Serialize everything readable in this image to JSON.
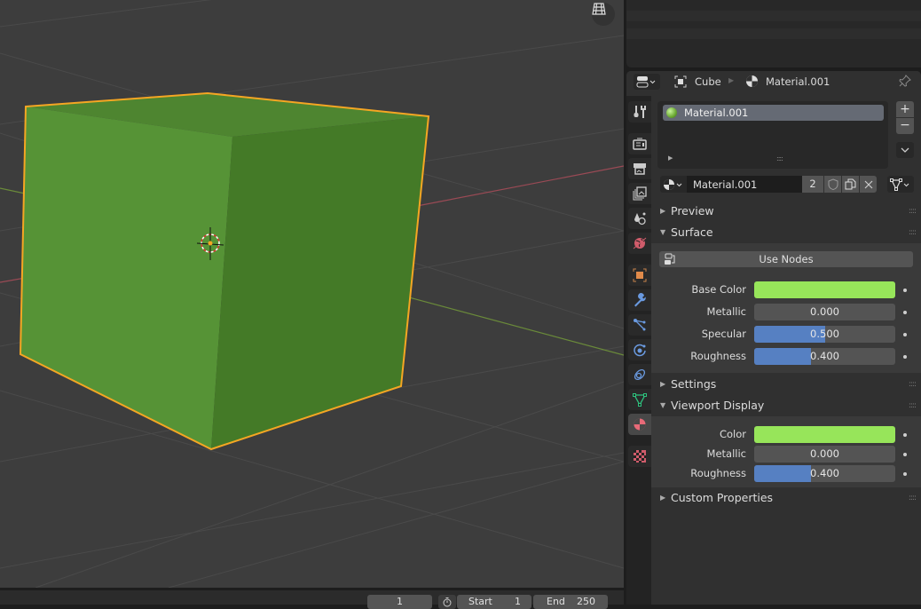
{
  "viewport": {
    "object_name": "Cube",
    "cube_color": "#5a9a36",
    "selection_outline_color": "#f5a623",
    "gizmo_icon": "grid-view-icon"
  },
  "timeline": {
    "current_frame": "1",
    "start_label": "Start",
    "start_value": "1",
    "end_label": "End",
    "end_value": "250",
    "stopwatch_icon": "stopwatch-icon"
  },
  "properties": {
    "header": {
      "editor_icon": "properties-editor-icon",
      "object_label": "Cube",
      "material_label": "Material.001",
      "pin_icon": "pin-icon"
    },
    "tabs": [
      {
        "name": "tool",
        "icon": "tool-icon",
        "color": "#cccccc"
      },
      {
        "name": "render",
        "icon": "render-icon",
        "color": "#cccccc"
      },
      {
        "name": "output",
        "icon": "output-icon",
        "color": "#cccccc"
      },
      {
        "name": "view-layer",
        "icon": "view-layer-icon",
        "color": "#cccccc"
      },
      {
        "name": "scene",
        "icon": "scene-icon",
        "color": "#cccccc"
      },
      {
        "name": "world",
        "icon": "world-icon",
        "color": "#d05c6b"
      },
      {
        "name": "object",
        "icon": "object-icon",
        "color": "#e08a4a"
      },
      {
        "name": "modifiers",
        "icon": "wrench-icon",
        "color": "#6a9ae0"
      },
      {
        "name": "particles",
        "icon": "particles-icon",
        "color": "#6a9ae0"
      },
      {
        "name": "physics",
        "icon": "physics-icon",
        "color": "#6a9ae0"
      },
      {
        "name": "constraints",
        "icon": "constraints-icon",
        "color": "#6a9ae0"
      },
      {
        "name": "data",
        "icon": "mesh-data-icon",
        "color": "#2ec27e"
      },
      {
        "name": "material",
        "icon": "material-icon",
        "color": "#e86a78",
        "active": true
      },
      {
        "name": "texture",
        "icon": "texture-icon",
        "color": "#d05c6b"
      }
    ],
    "slot_list": {
      "items": [
        {
          "label": "Material.001",
          "selected": true
        }
      ],
      "add_label": "+",
      "remove_label": "−"
    },
    "datablock": {
      "name": "Material.001",
      "users": "2"
    },
    "panels": {
      "preview": "Preview",
      "surface": "Surface",
      "use_nodes": "Use Nodes",
      "settings": "Settings",
      "viewport_display": "Viewport Display",
      "custom_properties": "Custom Properties"
    },
    "surface_props": [
      {
        "label": "Base Color",
        "type": "color",
        "color": "#97e55a"
      },
      {
        "label": "Metallic",
        "type": "slider",
        "value": "0.000",
        "fraction": 0.0
      },
      {
        "label": "Specular",
        "type": "slider",
        "value": "0.500",
        "fraction": 0.5
      },
      {
        "label": "Roughness",
        "type": "slider",
        "value": "0.400",
        "fraction": 0.4
      }
    ],
    "viewport_props": [
      {
        "label": "Color",
        "type": "color",
        "color": "#97e55a"
      },
      {
        "label": "Metallic",
        "type": "slider",
        "value": "0.000",
        "fraction": 0.0
      },
      {
        "label": "Roughness",
        "type": "slider",
        "value": "0.400",
        "fraction": 0.4
      }
    ]
  }
}
